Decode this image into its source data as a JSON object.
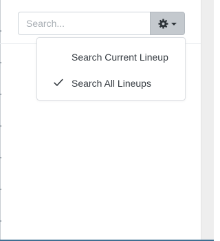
{
  "search": {
    "placeholder": "Search...",
    "value": ""
  },
  "settings_button": {
    "icon": "gear-icon",
    "caret": "chevron-down-icon"
  },
  "dropdown": {
    "items": [
      {
        "label": "Search Current Lineup",
        "checked": false
      },
      {
        "label": "Search All Lineups",
        "checked": true
      }
    ]
  },
  "colors": {
    "gear_button_bg": "#c4c9ce",
    "input_border": "#ced4da",
    "menu_border": "#dcdfe3",
    "text": "#343a40",
    "placeholder": "#a7adb3",
    "scroll_track": "#eeeeee"
  }
}
